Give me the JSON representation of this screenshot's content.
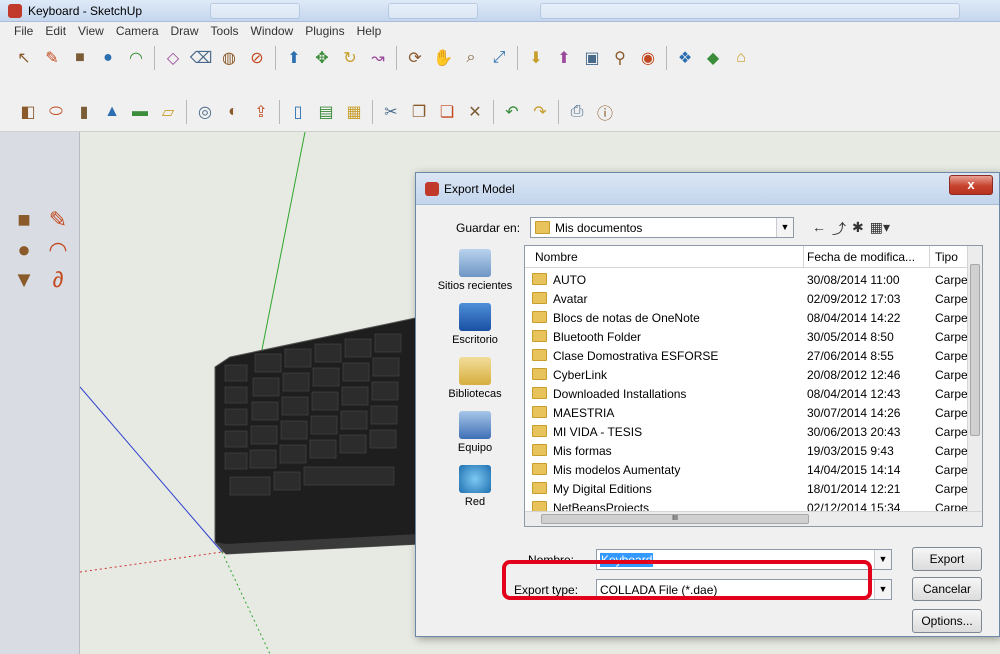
{
  "app": {
    "title": "Keyboard - SketchUp"
  },
  "menu": [
    "File",
    "Edit",
    "View",
    "Camera",
    "Draw",
    "Tools",
    "Window",
    "Plugins",
    "Help"
  ],
  "toolbar1": {
    "icons": [
      "select-arrow-icon",
      "pencil-line-icon",
      "rectangle-icon",
      "circle-icon",
      "arc-icon",
      "sep",
      "make-component-icon",
      "eraser-icon",
      "paint-bucket-icon",
      "tape-measure-icon",
      "sep",
      "push-pull-icon",
      "move-icon",
      "rotate-icon",
      "follow-me-icon",
      "sep",
      "orbit-icon",
      "pan-icon",
      "zoom-icon",
      "zoom-extents-icon",
      "sep",
      "get-models-icon",
      "share-model-icon",
      "photo-textures-icon",
      "add-location-icon",
      "google-earth-icon",
      "sep",
      "components-icon",
      "materials-icon",
      "warehouse-icon"
    ]
  },
  "toolbar2": {
    "icons": [
      "iso-view-icon",
      "top-view-icon",
      "front-view-icon",
      "right-view-icon",
      "back-view-icon",
      "left-view-icon",
      "sep",
      "bottom-view-icon",
      "section-plane-icon",
      "export-icon",
      "sep",
      "new-file-icon",
      "open-file-icon",
      "save-file-icon",
      "sep",
      "cut-icon",
      "copy-icon",
      "paste-icon",
      "delete-icon",
      "sep",
      "undo-icon",
      "redo-icon",
      "sep",
      "print-icon",
      "info-icon"
    ]
  },
  "palette": [
    "rectangle-icon",
    "pencil-icon",
    "circle-icon",
    "arc-icon",
    "polygon-icon",
    "freehand-icon"
  ],
  "dialog": {
    "title": "Export Model",
    "close_label": "x",
    "save_in_label": "Guardar en:",
    "save_in_value": "Mis documentos",
    "places": [
      "Sitios recientes",
      "Escritorio",
      "Bibliotecas",
      "Equipo",
      "Red"
    ],
    "columns": {
      "name": "Nombre",
      "date": "Fecha de modifica...",
      "type": "Tipo"
    },
    "files": [
      {
        "name": "AUTO",
        "date": "30/08/2014 11:00",
        "type": "Carpet"
      },
      {
        "name": "Avatar",
        "date": "02/09/2012 17:03",
        "type": "Carpet"
      },
      {
        "name": "Blocs de notas de OneNote",
        "date": "08/04/2014 14:22",
        "type": "Carpet"
      },
      {
        "name": "Bluetooth Folder",
        "date": "30/05/2014 8:50",
        "type": "Carpet"
      },
      {
        "name": "Clase Domostrativa ESFORSE",
        "date": "27/06/2014 8:55",
        "type": "Carpet"
      },
      {
        "name": "CyberLink",
        "date": "20/08/2012 12:46",
        "type": "Carpet"
      },
      {
        "name": "Downloaded Installations",
        "date": "08/04/2014 12:43",
        "type": "Carpet"
      },
      {
        "name": "MAESTRIA",
        "date": "30/07/2014 14:26",
        "type": "Carpet"
      },
      {
        "name": "MI VIDA - TESIS",
        "date": "30/06/2013 20:43",
        "type": "Carpet"
      },
      {
        "name": "Mis formas",
        "date": "19/03/2015 9:43",
        "type": "Carpet"
      },
      {
        "name": "Mis modelos Aumentaty",
        "date": "14/04/2015 14:14",
        "type": "Carpet"
      },
      {
        "name": "My Digital Editions",
        "date": "18/01/2014 12:21",
        "type": "Carpet"
      },
      {
        "name": "NetBeansProjects",
        "date": "02/12/2014 15:34",
        "type": "Carpet"
      }
    ],
    "filename_label": "Nombre:",
    "filename_value": "Keyboard",
    "type_label": "Export type:",
    "type_value": "COLLADA File (*.dae)",
    "export_button": "Export",
    "cancel_button": "Cancelar",
    "options_button": "Options..."
  },
  "colors": {
    "highlight": "#e2001a",
    "selection": "#3399ff",
    "folder": "#e8c35b"
  }
}
